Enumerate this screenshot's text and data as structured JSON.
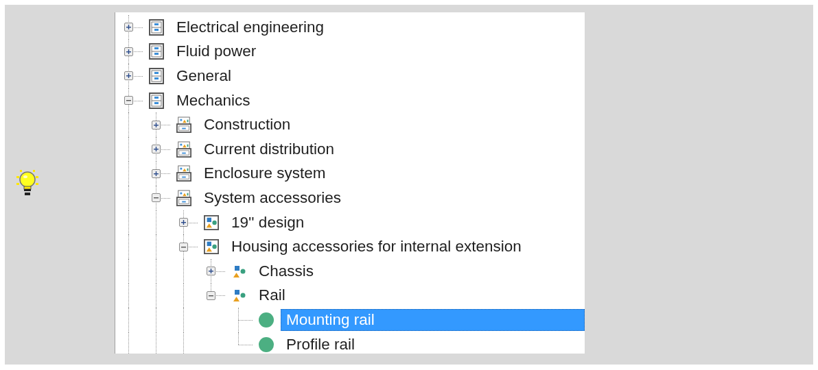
{
  "tree": [
    {
      "label": "Electrical engineering",
      "kind": "cabinet",
      "expanded": false,
      "selected": false
    },
    {
      "label": "Fluid power",
      "kind": "cabinet",
      "expanded": false,
      "selected": false
    },
    {
      "label": "General",
      "kind": "cabinet",
      "expanded": false,
      "selected": false
    },
    {
      "label": "Mechanics",
      "kind": "cabinet",
      "expanded": true,
      "selected": false,
      "children": [
        {
          "label": "Construction",
          "kind": "drawer",
          "expanded": false,
          "selected": false
        },
        {
          "label": "Current distribution",
          "kind": "drawer",
          "expanded": false,
          "selected": false
        },
        {
          "label": "Enclosure system",
          "kind": "drawer",
          "expanded": false,
          "selected": false
        },
        {
          "label": "System accessories",
          "kind": "drawer",
          "expanded": true,
          "selected": false,
          "children": [
            {
              "label": "19'' design",
              "kind": "framed_shapes",
              "expanded": false,
              "selected": false
            },
            {
              "label": "Housing accessories for internal extension",
              "kind": "framed_shapes",
              "expanded": true,
              "selected": false,
              "children": [
                {
                  "label": "Chassis",
                  "kind": "shapes",
                  "expanded": false,
                  "selected": false
                },
                {
                  "label": "Rail",
                  "kind": "shapes",
                  "expanded": true,
                  "selected": false,
                  "children": [
                    {
                      "label": "Mounting rail",
                      "kind": "part",
                      "selected": true
                    },
                    {
                      "label": "Profile rail",
                      "kind": "part",
                      "selected": false
                    }
                  ]
                }
              ]
            }
          ]
        }
      ]
    }
  ]
}
